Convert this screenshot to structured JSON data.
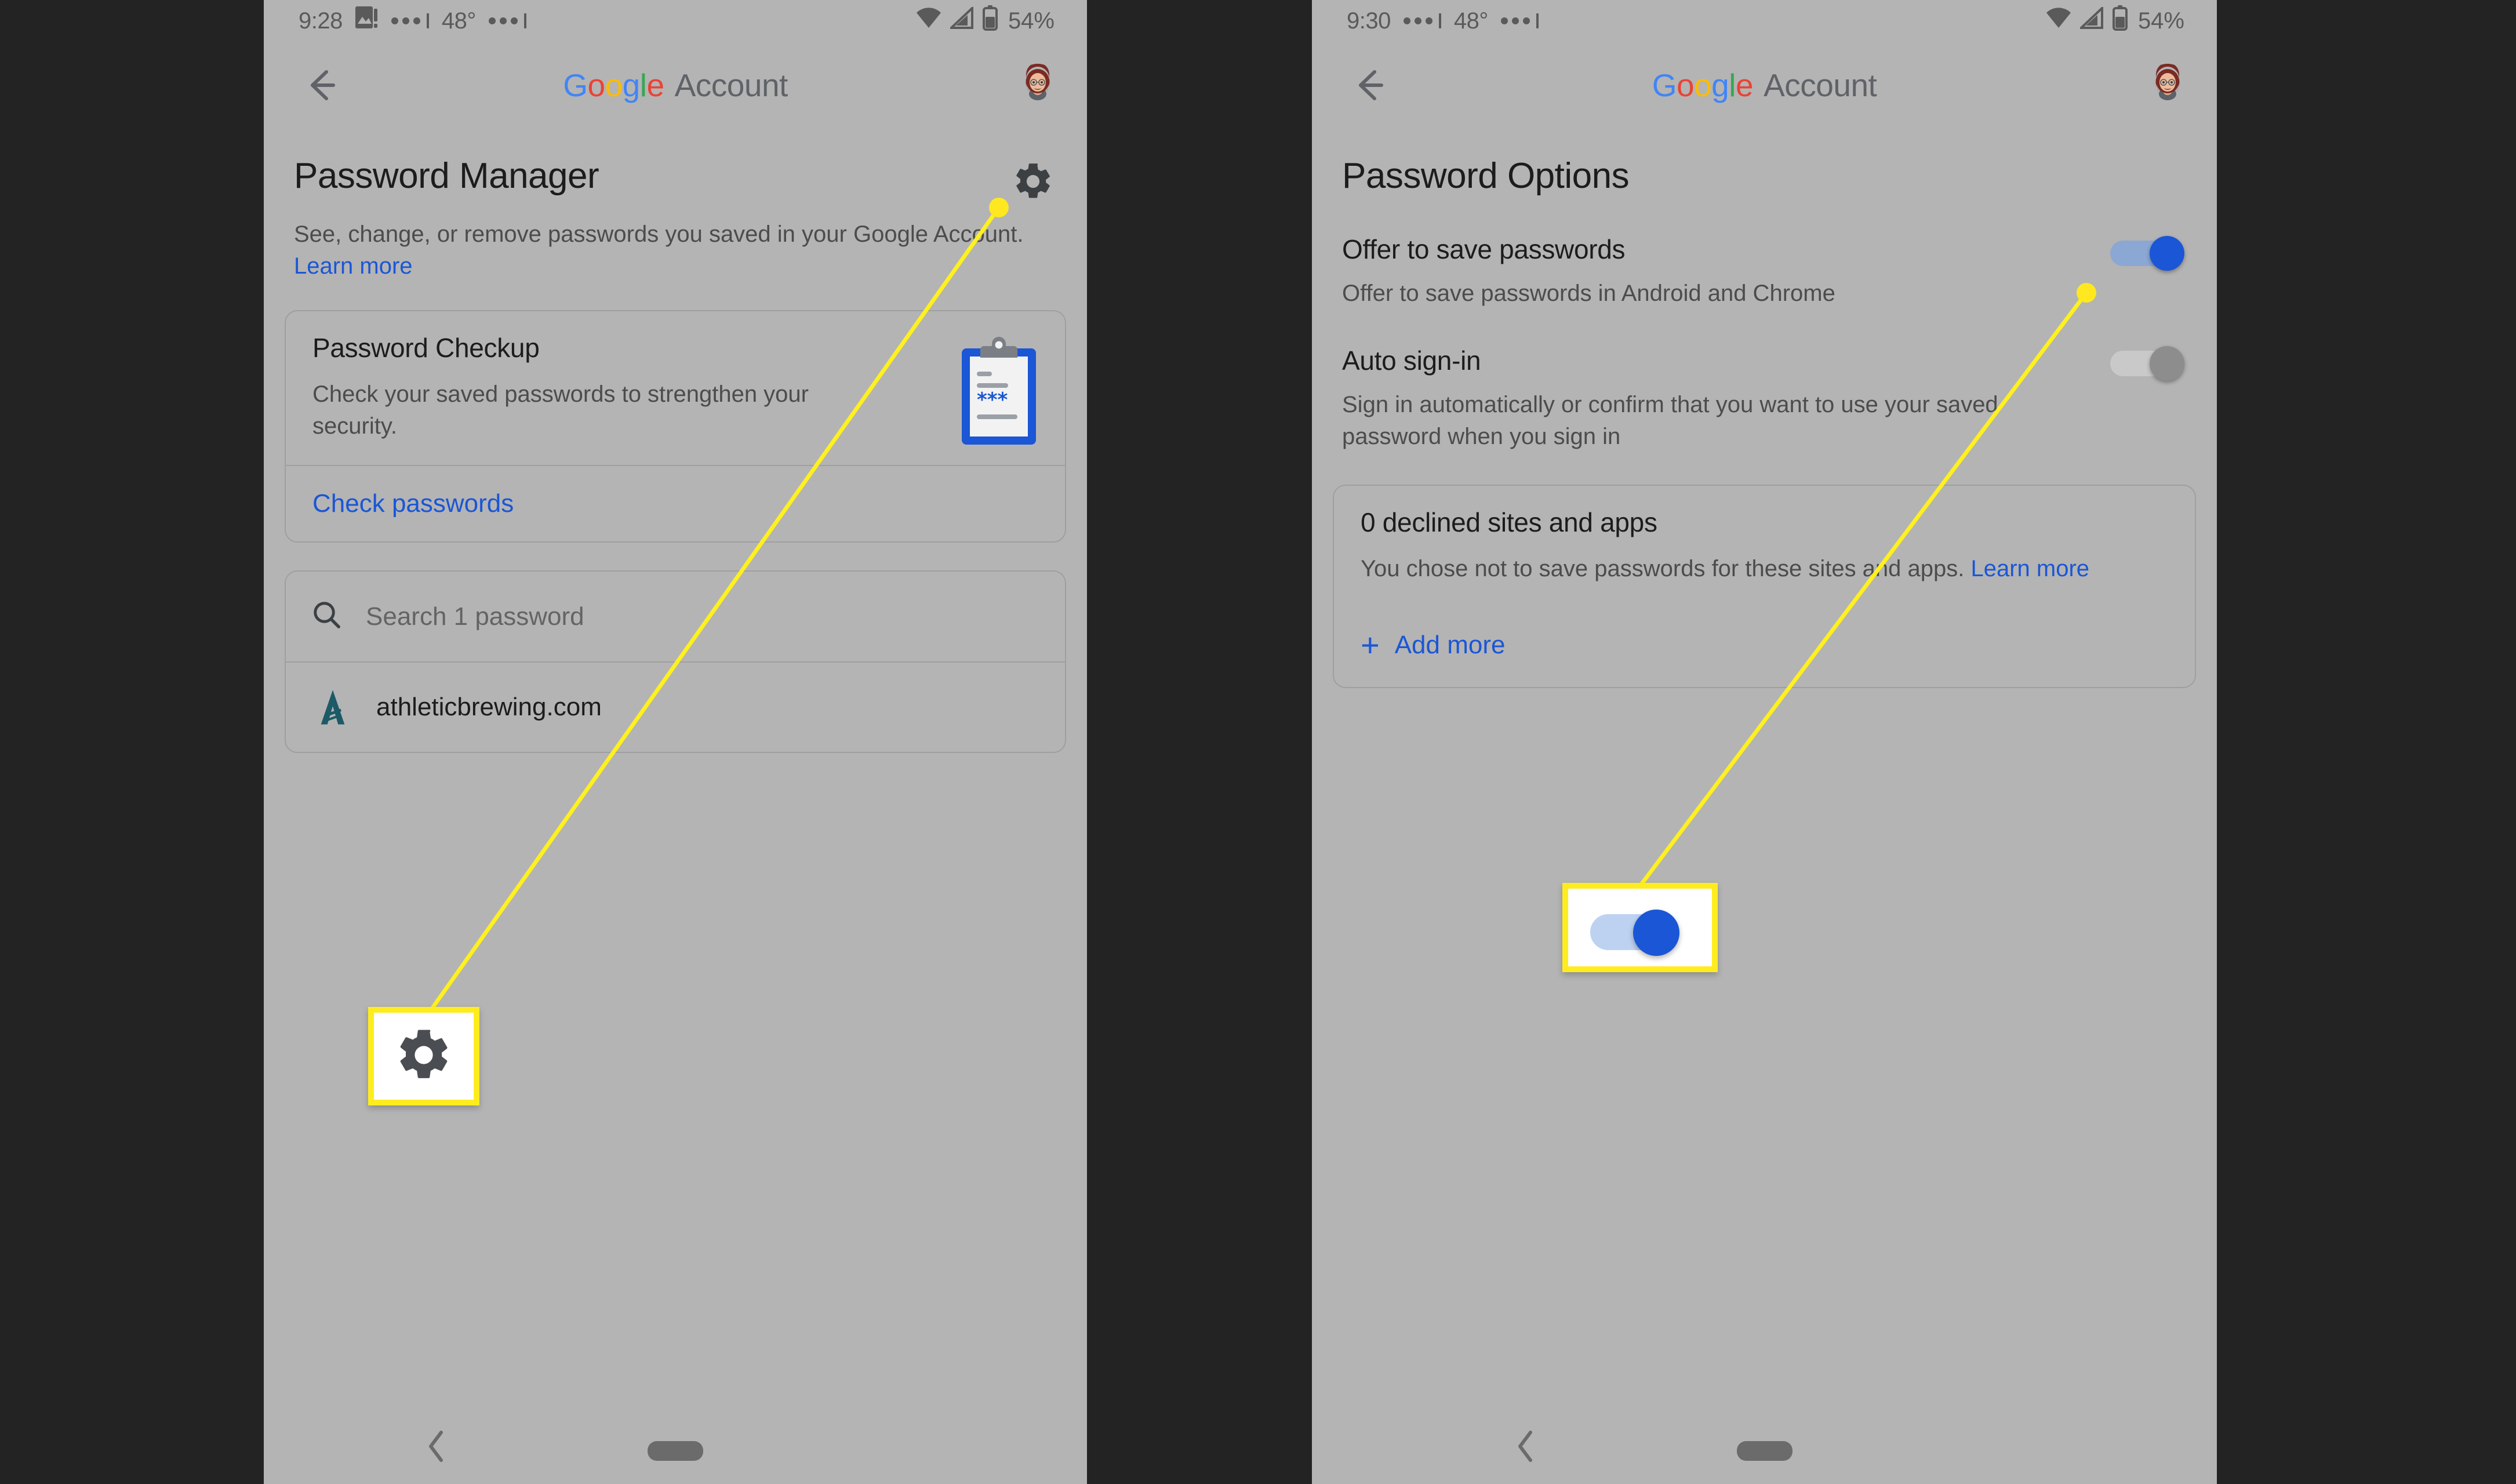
{
  "left_phone": {
    "status_bar": {
      "time": "9:28",
      "icons": [
        "photo-warning-icon",
        "dots-icon",
        "dots-icon"
      ],
      "temperature": "48°",
      "wifi": "wifi-icon",
      "signal": "signal-icon",
      "battery": "battery-icon",
      "battery_percent": "54%"
    },
    "action_bar": {
      "back": "back-arrow-icon",
      "brand_google": "Google",
      "brand_account": "Account",
      "avatar": "user-avatar"
    },
    "page_title": "Password Manager",
    "subtitle_text": "See, change, or remove passwords you saved in your Google Account. ",
    "subtitle_link": "Learn more",
    "settings_icon": "gear-icon",
    "checkup_card": {
      "title": "Password Checkup",
      "description": "Check your saved passwords to strengthen your security.",
      "icon": "clipboard-password-icon",
      "action": "Check passwords"
    },
    "search": {
      "icon": "search-icon",
      "placeholder": "Search 1 password"
    },
    "saved_items": [
      {
        "icon": "athletic-brewing-favicon",
        "name": "athleticbrewing.com"
      }
    ],
    "nav": {
      "back": "nav-back-icon",
      "home": "nav-home-pill"
    }
  },
  "right_phone": {
    "status_bar": {
      "time": "9:30",
      "icons": [
        "dots-icon",
        "dots-icon"
      ],
      "temperature": "48°",
      "wifi": "wifi-icon",
      "signal": "signal-icon",
      "battery": "battery-icon",
      "battery_percent": "54%"
    },
    "action_bar": {
      "back": "back-arrow-icon",
      "brand_google": "Google",
      "brand_account": "Account",
      "avatar": "user-avatar"
    },
    "page_title": "Password Options",
    "options": [
      {
        "title": "Offer to save passwords",
        "description": "Offer to save passwords in Android and Chrome",
        "state": "on"
      },
      {
        "title": "Auto sign-in",
        "description": "Sign in automatically or confirm that you want to use your saved password when you sign in",
        "state": "off"
      }
    ],
    "declined_card": {
      "title": "0 declined sites and apps",
      "description": "You chose not to save passwords for these sites and apps. ",
      "description_link": "Learn more",
      "add_label": "Add more",
      "add_icon": "plus-icon"
    },
    "nav": {
      "back": "nav-back-icon",
      "home": "nav-home-pill"
    }
  },
  "callouts": [
    {
      "id": "gear",
      "icon": "gear-icon",
      "border_color": "#ffec1f"
    },
    {
      "id": "toggle",
      "icon": "toggle-on-icon",
      "border_color": "#ffec1f"
    }
  ],
  "colors": {
    "background": "#232323",
    "panel": "#b4b4b4",
    "link": "#1a56d6",
    "highlight": "#ffec1f",
    "toggle_on": "#1a56d6",
    "toggle_off": "#8d8d8d"
  }
}
